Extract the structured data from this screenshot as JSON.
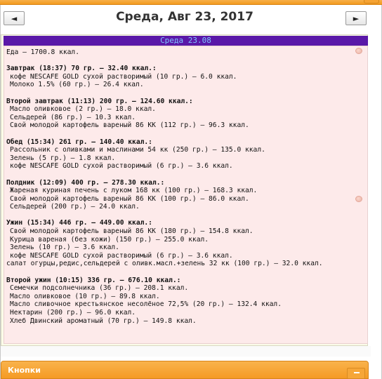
{
  "nav": {
    "prev_label": "◄",
    "next_label": "►"
  },
  "date_title": "Среда, Авг 23, 2017",
  "day_header": "Среда 23.08",
  "total": "Еда — 1700.8 ккал.",
  "meals": [
    {
      "title": "Завтрак (18:37) 70 гр. — 32.40 ккал.:",
      "items": [
        "кофе NESCAFE GOLD сухой растворимый (10 гр.) — 6.0 ккал.",
        "Молоко 1.5% (60 гр.) — 26.4 ккал."
      ]
    },
    {
      "title": "Второй завтрак (11:13) 200 гр. — 124.60 ккал.:",
      "items": [
        "Масло оливковое (2 гр.) — 18.0 ккал.",
        "Сельдерей (86 гр.) — 10.3 ккал.",
        "Свой молодой картофель вареный 86 КК (112 гр.) — 96.3 ккал."
      ]
    },
    {
      "title": "Обед (15:34) 261 гр. — 140.40 ккал.:",
      "items": [
        "Рассольник с оливками и маслинами 54 кк (250 гр.) — 135.0 ккал.",
        "Зелень (5 гр.) — 1.8 ккал.",
        "кофе NESCAFE GOLD сухой растворимый (6 гр.) — 3.6 ккал."
      ]
    },
    {
      "title": "Полдник (12:09) 400 гр. — 278.30 ккал.:",
      "items": [
        "Жареная куриная печень с луком 168 кк (100 гр.) — 168.3 ккал.",
        "Свой молодой картофель вареный 86 КК (100 гр.) — 86.0 ккал.",
        "Сельдерей (200 гр.) — 24.0 ккал."
      ]
    },
    {
      "title": "Ужин (15:34) 446 гр. — 449.00 ккал.:",
      "items": [
        "Свой молодой картофель вареный 86 КК (180 гр.) — 154.8 ккал.",
        "Курица вареная (без кожи) (150 гр.) — 255.0 ккал.",
        "Зелень (10 гр.) — 3.6 ккал.",
        "кофе NESCAFE GOLD сухой растворимый (6 гр.) — 3.6 ккал.",
        "салат огурцы,редис,сельдерей с оливк.масл.+зелень 32 кк (100 гр.) — 32.0 ккал."
      ]
    },
    {
      "title": "Второй ужин (10:15) 336 гр. — 676.10 ккал.:",
      "items": [
        "Семечки подсолнечника (36 гр.) — 208.1 ккал.",
        "Масло оливковое (10 гр.) — 89.8 ккал.",
        "Масло сливочное крестьянское несолёное 72,5% (20 гр.) — 132.4 ккал.",
        "Нектарин (200 гр.) — 96.0 ккал.",
        "Хлеб Двинский ароматный (70 гр.) — 149.8 ккал."
      ]
    }
  ],
  "buttons_panel": {
    "label": "Кнопки"
  },
  "icons": {
    "meal_marker": "peach-dot-icon"
  },
  "colors": {
    "accent_orange": "#f59b24",
    "header_purple": "#5a18a8",
    "header_text": "#7ec4ff",
    "body_pink": "#fdeaea"
  }
}
